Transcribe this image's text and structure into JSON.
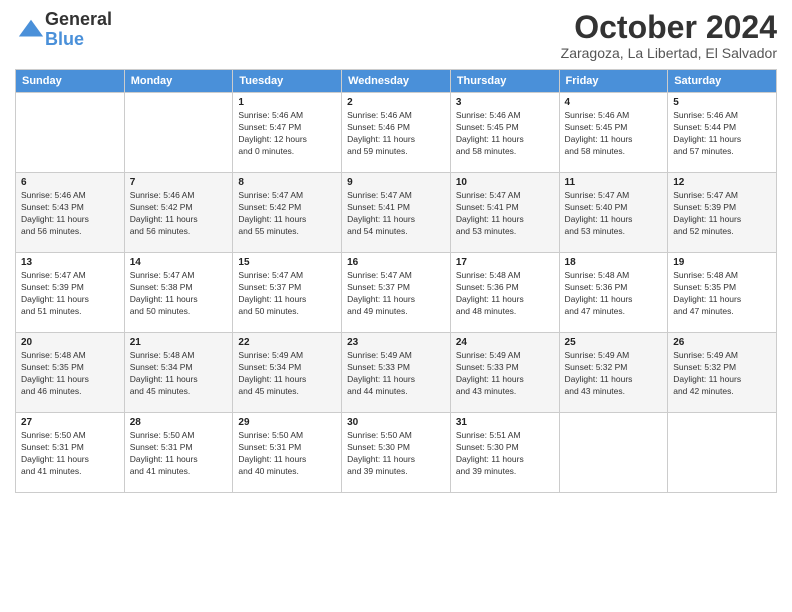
{
  "logo": {
    "general": "General",
    "blue": "Blue"
  },
  "header": {
    "month": "October 2024",
    "location": "Zaragoza, La Libertad, El Salvador"
  },
  "days_of_week": [
    "Sunday",
    "Monday",
    "Tuesday",
    "Wednesday",
    "Thursday",
    "Friday",
    "Saturday"
  ],
  "weeks": [
    [
      {
        "day": "",
        "info": ""
      },
      {
        "day": "",
        "info": ""
      },
      {
        "day": "1",
        "info": "Sunrise: 5:46 AM\nSunset: 5:47 PM\nDaylight: 12 hours\nand 0 minutes."
      },
      {
        "day": "2",
        "info": "Sunrise: 5:46 AM\nSunset: 5:46 PM\nDaylight: 11 hours\nand 59 minutes."
      },
      {
        "day": "3",
        "info": "Sunrise: 5:46 AM\nSunset: 5:45 PM\nDaylight: 11 hours\nand 58 minutes."
      },
      {
        "day": "4",
        "info": "Sunrise: 5:46 AM\nSunset: 5:45 PM\nDaylight: 11 hours\nand 58 minutes."
      },
      {
        "day": "5",
        "info": "Sunrise: 5:46 AM\nSunset: 5:44 PM\nDaylight: 11 hours\nand 57 minutes."
      }
    ],
    [
      {
        "day": "6",
        "info": "Sunrise: 5:46 AM\nSunset: 5:43 PM\nDaylight: 11 hours\nand 56 minutes."
      },
      {
        "day": "7",
        "info": "Sunrise: 5:46 AM\nSunset: 5:42 PM\nDaylight: 11 hours\nand 56 minutes."
      },
      {
        "day": "8",
        "info": "Sunrise: 5:47 AM\nSunset: 5:42 PM\nDaylight: 11 hours\nand 55 minutes."
      },
      {
        "day": "9",
        "info": "Sunrise: 5:47 AM\nSunset: 5:41 PM\nDaylight: 11 hours\nand 54 minutes."
      },
      {
        "day": "10",
        "info": "Sunrise: 5:47 AM\nSunset: 5:41 PM\nDaylight: 11 hours\nand 53 minutes."
      },
      {
        "day": "11",
        "info": "Sunrise: 5:47 AM\nSunset: 5:40 PM\nDaylight: 11 hours\nand 53 minutes."
      },
      {
        "day": "12",
        "info": "Sunrise: 5:47 AM\nSunset: 5:39 PM\nDaylight: 11 hours\nand 52 minutes."
      }
    ],
    [
      {
        "day": "13",
        "info": "Sunrise: 5:47 AM\nSunset: 5:39 PM\nDaylight: 11 hours\nand 51 minutes."
      },
      {
        "day": "14",
        "info": "Sunrise: 5:47 AM\nSunset: 5:38 PM\nDaylight: 11 hours\nand 50 minutes."
      },
      {
        "day": "15",
        "info": "Sunrise: 5:47 AM\nSunset: 5:37 PM\nDaylight: 11 hours\nand 50 minutes."
      },
      {
        "day": "16",
        "info": "Sunrise: 5:47 AM\nSunset: 5:37 PM\nDaylight: 11 hours\nand 49 minutes."
      },
      {
        "day": "17",
        "info": "Sunrise: 5:48 AM\nSunset: 5:36 PM\nDaylight: 11 hours\nand 48 minutes."
      },
      {
        "day": "18",
        "info": "Sunrise: 5:48 AM\nSunset: 5:36 PM\nDaylight: 11 hours\nand 47 minutes."
      },
      {
        "day": "19",
        "info": "Sunrise: 5:48 AM\nSunset: 5:35 PM\nDaylight: 11 hours\nand 47 minutes."
      }
    ],
    [
      {
        "day": "20",
        "info": "Sunrise: 5:48 AM\nSunset: 5:35 PM\nDaylight: 11 hours\nand 46 minutes."
      },
      {
        "day": "21",
        "info": "Sunrise: 5:48 AM\nSunset: 5:34 PM\nDaylight: 11 hours\nand 45 minutes."
      },
      {
        "day": "22",
        "info": "Sunrise: 5:49 AM\nSunset: 5:34 PM\nDaylight: 11 hours\nand 45 minutes."
      },
      {
        "day": "23",
        "info": "Sunrise: 5:49 AM\nSunset: 5:33 PM\nDaylight: 11 hours\nand 44 minutes."
      },
      {
        "day": "24",
        "info": "Sunrise: 5:49 AM\nSunset: 5:33 PM\nDaylight: 11 hours\nand 43 minutes."
      },
      {
        "day": "25",
        "info": "Sunrise: 5:49 AM\nSunset: 5:32 PM\nDaylight: 11 hours\nand 43 minutes."
      },
      {
        "day": "26",
        "info": "Sunrise: 5:49 AM\nSunset: 5:32 PM\nDaylight: 11 hours\nand 42 minutes."
      }
    ],
    [
      {
        "day": "27",
        "info": "Sunrise: 5:50 AM\nSunset: 5:31 PM\nDaylight: 11 hours\nand 41 minutes."
      },
      {
        "day": "28",
        "info": "Sunrise: 5:50 AM\nSunset: 5:31 PM\nDaylight: 11 hours\nand 41 minutes."
      },
      {
        "day": "29",
        "info": "Sunrise: 5:50 AM\nSunset: 5:31 PM\nDaylight: 11 hours\nand 40 minutes."
      },
      {
        "day": "30",
        "info": "Sunrise: 5:50 AM\nSunset: 5:30 PM\nDaylight: 11 hours\nand 39 minutes."
      },
      {
        "day": "31",
        "info": "Sunrise: 5:51 AM\nSunset: 5:30 PM\nDaylight: 11 hours\nand 39 minutes."
      },
      {
        "day": "",
        "info": ""
      },
      {
        "day": "",
        "info": ""
      }
    ]
  ]
}
